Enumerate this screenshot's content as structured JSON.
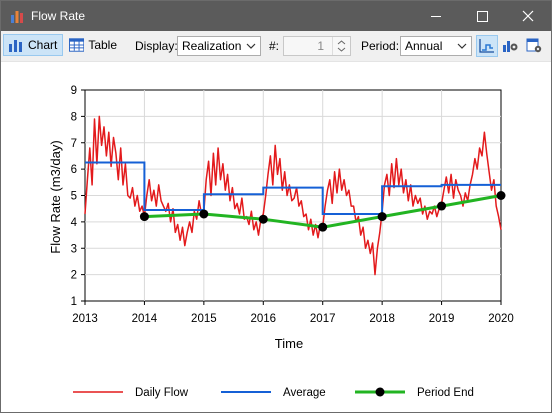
{
  "window": {
    "title": "Flow Rate",
    "icons": {
      "app": "bar-chart-icon",
      "minimize": "minimize-icon",
      "maximize": "maximize-icon",
      "close": "close-icon"
    }
  },
  "toolbar": {
    "chart_label": "Chart",
    "table_label": "Table",
    "display_label": "Display:",
    "display_value": "Realization",
    "number_label": "#:",
    "number_value": "1",
    "period_label": "Period:",
    "period_value": "Annual",
    "icons": [
      "chart-icon",
      "table-icon",
      "step-chart-icon",
      "settings-icon",
      "export-icon"
    ]
  },
  "chart_data": {
    "type": "line",
    "xlabel": "Time",
    "ylabel": "Flow Rate (m3/day)",
    "xlim": [
      2013,
      2020
    ],
    "ylim": [
      1,
      9
    ],
    "x_ticks": [
      "2013",
      "2014",
      "2015",
      "2016",
      "2017",
      "2018",
      "2019",
      "2020"
    ],
    "y_ticks": [
      "1",
      "2",
      "3",
      "4",
      "5",
      "6",
      "7",
      "8",
      "9"
    ],
    "grid": true,
    "legend_position": "bottom",
    "series": [
      {
        "name": "Daily Flow",
        "color": "#e31a1c",
        "x": [
          2013.0,
          2013.04,
          2013.08,
          2013.12,
          2013.16,
          2013.2,
          2013.24,
          2013.28,
          2013.32,
          2013.36,
          2013.4,
          2013.44,
          2013.48,
          2013.52,
          2013.56,
          2013.6,
          2013.64,
          2013.68,
          2013.72,
          2013.76,
          2013.8,
          2013.84,
          2013.88,
          2013.92,
          2013.96,
          2014.0,
          2014.04,
          2014.08,
          2014.12,
          2014.16,
          2014.2,
          2014.24,
          2014.28,
          2014.32,
          2014.36,
          2014.4,
          2014.44,
          2014.48,
          2014.52,
          2014.56,
          2014.6,
          2014.64,
          2014.68,
          2014.72,
          2014.76,
          2014.8,
          2014.84,
          2014.88,
          2014.92,
          2014.96,
          2015.0,
          2015.04,
          2015.08,
          2015.12,
          2015.16,
          2015.2,
          2015.24,
          2015.28,
          2015.32,
          2015.36,
          2015.4,
          2015.44,
          2015.48,
          2015.52,
          2015.56,
          2015.6,
          2015.64,
          2015.68,
          2015.72,
          2015.76,
          2015.8,
          2015.84,
          2015.88,
          2015.92,
          2015.96,
          2016.0,
          2016.04,
          2016.08,
          2016.12,
          2016.16,
          2016.2,
          2016.24,
          2016.28,
          2016.32,
          2016.36,
          2016.4,
          2016.44,
          2016.48,
          2016.52,
          2016.56,
          2016.6,
          2016.64,
          2016.68,
          2016.72,
          2016.76,
          2016.8,
          2016.84,
          2016.88,
          2016.92,
          2016.96,
          2017.0,
          2017.04,
          2017.08,
          2017.12,
          2017.16,
          2017.2,
          2017.24,
          2017.28,
          2017.32,
          2017.36,
          2017.4,
          2017.44,
          2017.48,
          2017.52,
          2017.56,
          2017.6,
          2017.64,
          2017.68,
          2017.72,
          2017.76,
          2017.8,
          2017.84,
          2017.88,
          2017.92,
          2017.96,
          2018.0,
          2018.04,
          2018.08,
          2018.12,
          2018.16,
          2018.2,
          2018.24,
          2018.28,
          2018.32,
          2018.36,
          2018.4,
          2018.44,
          2018.48,
          2018.52,
          2018.56,
          2018.6,
          2018.64,
          2018.68,
          2018.72,
          2018.76,
          2018.8,
          2018.84,
          2018.88,
          2018.92,
          2018.96,
          2019.0,
          2019.04,
          2019.08,
          2019.12,
          2019.16,
          2019.2,
          2019.24,
          2019.28,
          2019.32,
          2019.36,
          2019.4,
          2019.44,
          2019.48,
          2019.52,
          2019.56,
          2019.6,
          2019.64,
          2019.68,
          2019.72,
          2019.76,
          2019.8,
          2019.84,
          2019.88,
          2019.92,
          2019.96,
          2020.0
        ],
        "values": [
          4.3,
          5.6,
          6.8,
          5.4,
          7.9,
          6.2,
          8.0,
          6.9,
          7.6,
          6.5,
          7.4,
          6.1,
          7.2,
          6.6,
          5.6,
          6.8,
          5.4,
          6.2,
          5.0,
          4.9,
          5.3,
          4.6,
          5.0,
          4.4,
          4.6,
          4.2,
          5.0,
          5.6,
          4.8,
          5.2,
          4.6,
          5.4,
          4.8,
          4.6,
          4.4,
          4.7,
          4.0,
          4.5,
          3.6,
          3.9,
          3.3,
          3.8,
          3.1,
          3.6,
          4.0,
          3.6,
          4.4,
          4.1,
          4.8,
          4.3,
          4.4,
          5.6,
          6.3,
          5.0,
          6.6,
          5.4,
          6.8,
          5.6,
          6.2,
          5.2,
          5.8,
          4.8,
          5.3,
          4.5,
          4.7,
          4.3,
          4.9,
          4.1,
          4.2,
          3.9,
          4.4,
          3.7,
          4.0,
          3.5,
          4.1,
          4.3,
          5.0,
          5.8,
          6.5,
          5.4,
          6.9,
          5.8,
          6.4,
          5.2,
          5.9,
          5.0,
          5.4,
          4.8,
          4.9,
          5.3,
          4.6,
          4.8,
          4.2,
          4.3,
          3.7,
          4.1,
          3.5,
          3.9,
          3.4,
          3.9,
          3.8,
          4.6,
          5.2,
          5.6,
          4.7,
          5.9,
          5.1,
          6.0,
          5.2,
          5.6,
          5.0,
          5.2,
          4.6,
          4.6,
          4.0,
          4.2,
          3.5,
          3.8,
          3.0,
          3.3,
          2.8,
          3.2,
          2.0,
          3.0,
          3.6,
          4.4,
          5.4,
          5.8,
          5.0,
          6.2,
          5.3,
          6.4,
          5.4,
          6.0,
          5.1,
          5.6,
          4.8,
          5.4,
          4.6,
          5.0,
          4.7,
          4.9,
          4.3,
          4.6,
          4.1,
          4.4,
          4.3,
          4.6,
          4.2,
          4.5,
          4.7,
          5.2,
          5.7,
          5.1,
          5.8,
          4.9,
          5.6,
          5.2,
          5.0,
          4.6,
          5.1,
          4.8,
          5.4,
          5.8,
          6.4,
          6.0,
          6.8,
          6.5,
          7.4,
          6.6,
          5.9,
          5.2,
          5.6,
          4.6,
          4.2,
          3.7
        ]
      },
      {
        "name": "Average",
        "color": "#1560d6",
        "step": true,
        "x": [
          2013,
          2014,
          2014,
          2015,
          2015,
          2016,
          2016,
          2017,
          2017,
          2018,
          2018,
          2019,
          2019,
          2020
        ],
        "values": [
          6.25,
          6.25,
          4.45,
          4.45,
          5.05,
          5.05,
          5.3,
          5.3,
          4.3,
          4.3,
          5.35,
          5.35,
          5.4,
          5.4
        ]
      },
      {
        "name": "Period End",
        "color": "#22b422",
        "marker_color": "#000000",
        "x": [
          2014,
          2015,
          2016,
          2017,
          2018,
          2019,
          2020
        ],
        "values": [
          4.2,
          4.3,
          4.1,
          3.8,
          4.2,
          4.6,
          5.0
        ]
      }
    ]
  }
}
